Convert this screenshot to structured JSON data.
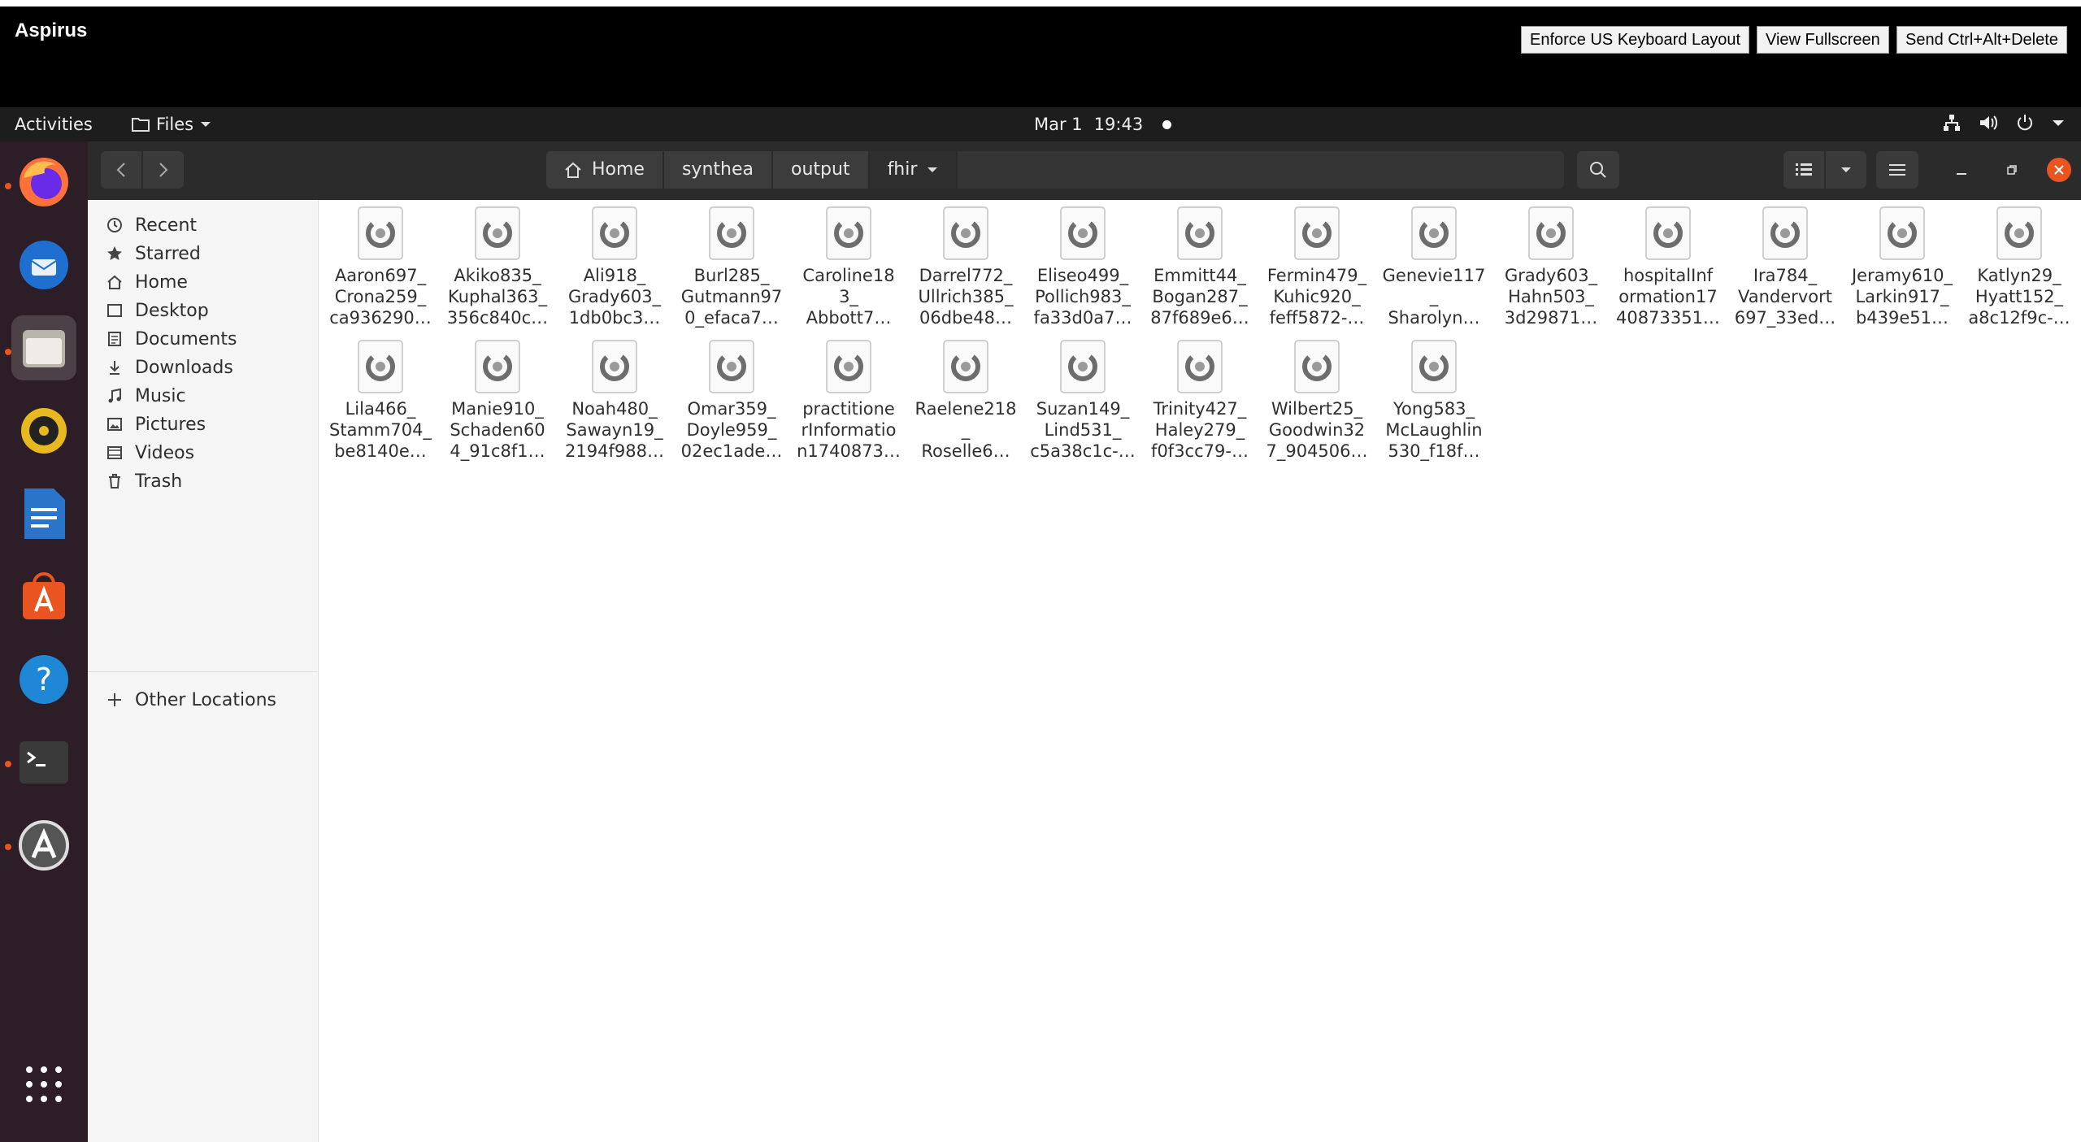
{
  "viewer": {
    "title": "Aspirus",
    "buttons": [
      "Enforce US Keyboard Layout",
      "View Fullscreen",
      "Send Ctrl+Alt+Delete"
    ]
  },
  "panel": {
    "activities": "Activities",
    "app_menu": "Files",
    "date": "Mar 1",
    "time": "19:43"
  },
  "dock": {
    "items": [
      "firefox-icon",
      "thunderbird-icon",
      "files-icon",
      "rhythmbox-icon",
      "writer-icon",
      "app-center-icon",
      "help-icon",
      "terminal-icon",
      "update-icon"
    ],
    "show_apps": "show-apps-icon"
  },
  "path": {
    "crumbs": [
      "Home",
      "synthea",
      "output",
      "fhir"
    ]
  },
  "sidebar": {
    "items": [
      "Recent",
      "Starred",
      "Home",
      "Desktop",
      "Documents",
      "Downloads",
      "Music",
      "Pictures",
      "Videos",
      "Trash"
    ],
    "other": "Other Locations"
  },
  "files": [
    "Aaron697_\nCrona259_\nca936290…",
    "Akiko835_\nKuphal363_\n356c840c…",
    "Ali918_\nGrady603_\n1db0bc3…",
    "Burl285_\nGutmann97\n0_efaca7…",
    "Caroline18\n3_\nAbbott7…",
    "Darrel772_\nUllrich385_\n06dbe48…",
    "Eliseo499_\nPollich983_\nfa33d0a7…",
    "Emmitt44_\nBogan287_\n87f689e6…",
    "Fermin479_\nKuhic920_\nfeff5872-…",
    "Genevie117\n_\nSharolyn…",
    "Grady603_\nHahn503_\n3d29871…",
    "hospitalInf\normation17\n40873351…",
    "Ira784_\nVandervort\n697_33ed…",
    "Jeramy610_\nLarkin917_\nb439e51…",
    "Katlyn29_\nHyatt152_\na8c12f9c-…",
    "Lila466_\nStamm704_\nbe8140e…",
    "Manie910_\nSchaden60\n4_91c8f1…",
    "Noah480_\nSawayn19_\n2194f988…",
    "Omar359_\nDoyle959_\n02ec1ade…",
    "practitione\nrInformatio\nn1740873…",
    "Raelene218\n_\nRoselle6…",
    "Suzan149_\nLind531_\nc5a38c1c-…",
    "Trinity427_\nHaley279_\nf0f3cc79-…",
    "Wilbert25_\nGoodwin32\n7_904506…",
    "Yong583_\nMcLaughlin\n530_f18f…"
  ]
}
